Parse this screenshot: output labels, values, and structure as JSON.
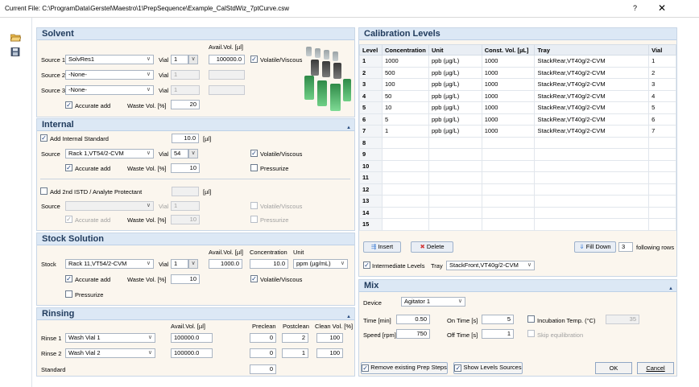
{
  "title": "Current File: C:\\ProgramData\\Gerstel\\Maestro\\1\\PrepSequence\\Example_CalStdWiz_7ptCurve.csw",
  "title_help": "?",
  "title_close": "✕",
  "solvent": {
    "header": "Solvent",
    "avail_vol_header": "Avail.Vol. [µl]",
    "source1_label": "Source 1",
    "source1_value": "SolvRes1",
    "source1_vial_label": "Vial",
    "source1_vial": "1",
    "source1_avail": "100000.0",
    "volatile_label": "Volatile/Viscous",
    "source2_label": "Source 2",
    "source2_value": "-None-",
    "source2_vial_label": "Vial",
    "source2_vial": "1",
    "source3_label": "Source 3",
    "source3_value": "-None-",
    "source3_vial_label": "Vial",
    "source3_vial": "1",
    "accurate_label": "Accurate add",
    "waste_label": "Waste Vol. [%]",
    "waste_value": "20"
  },
  "internal": {
    "header": "Internal",
    "add_is_label": "Add Internal Standard",
    "add_is_value": "10.0",
    "add_is_unit": "[µl]",
    "source_label": "Source",
    "source_value": "Rack 1,VT54/2-CVM",
    "vial_label": "Vial",
    "vial_value": "54",
    "volatile_label": "Volatile/Viscous",
    "accurate_label": "Accurate add",
    "waste_label": "Waste Vol. [%]",
    "waste_value": "10",
    "pressurize_label": "Pressurize",
    "add2_label": "Add 2nd ISTD / Analyte Protectant",
    "add2_unit": "[µl]",
    "source2_label": "Source",
    "vial2_label": "Vial",
    "vial2_value": "1",
    "volatile2_label": "Volatile/Viscous",
    "accurate2_label": "Accurate add",
    "waste2_label": "Waste Vol. [%]",
    "waste2_value": "10",
    "pressurize2_label": "Pressurize"
  },
  "stock": {
    "header": "Stock Solution",
    "avail_header": "Avail.Vol. [µl]",
    "conc_header": "Concentration",
    "unit_header": "Unit",
    "stock_label": "Stock",
    "stock_value": "Rack 11,VT54/2-CVM",
    "vial_label": "Vial",
    "vial_value": "1",
    "avail_value": "1000.0",
    "conc_value": "10.0",
    "unit_value": "ppm (µg/mL)",
    "accurate_label": "Accurate add",
    "waste_label": "Waste Vol. [%]",
    "waste_value": "10",
    "volatile_label": "Volatile/Viscous",
    "pressurize_label": "Pressurize"
  },
  "rinsing": {
    "header": "Rinsing",
    "avail_header": "Avail.Vol. [µl]",
    "preclean_header": "Preclean",
    "postclean_header": "Postclean",
    "cleanvol_header": "Clean Vol. [%]",
    "rinse1_label": "Rinse 1",
    "rinse1_value": "Wash Vial 1",
    "rinse1_avail": "100000.0",
    "rinse1_pre": "0",
    "rinse1_post": "2",
    "rinse1_clean": "100",
    "rinse2_label": "Rinse 2",
    "rinse2_value": "Wash Vial 2",
    "rinse2_avail": "100000.0",
    "rinse2_pre": "0",
    "rinse2_post": "1",
    "rinse2_clean": "100",
    "standard_label": "Standard",
    "standard_pre": "0"
  },
  "calibration": {
    "header": "Calibration Levels",
    "columns": [
      "Level",
      "Concentration",
      "Unit",
      "Const. Vol. [µL]",
      "Tray",
      "Vial"
    ],
    "rows": [
      [
        "1",
        "1000",
        "ppb (µg/L)",
        "1000",
        "StackRear,VT40g/2-CVM",
        "1"
      ],
      [
        "2",
        "500",
        "ppb (µg/L)",
        "1000",
        "StackRear,VT40g/2-CVM",
        "2"
      ],
      [
        "3",
        "100",
        "ppb (µg/L)",
        "1000",
        "StackRear,VT40g/2-CVM",
        "3"
      ],
      [
        "4",
        "50",
        "ppb (µg/L)",
        "1000",
        "StackRear,VT40g/2-CVM",
        "4"
      ],
      [
        "5",
        "10",
        "ppb (µg/L)",
        "1000",
        "StackRear,VT40g/2-CVM",
        "5"
      ],
      [
        "6",
        "5",
        "ppb (µg/L)",
        "1000",
        "StackRear,VT40g/2-CVM",
        "6"
      ],
      [
        "7",
        "1",
        "ppb (µg/L)",
        "1000",
        "StackRear,VT40g/2-CVM",
        "7"
      ],
      [
        "8",
        "",
        "",
        "",
        "",
        ""
      ],
      [
        "9",
        "",
        "",
        "",
        "",
        ""
      ],
      [
        "10",
        "",
        "",
        "",
        "",
        ""
      ],
      [
        "11",
        "",
        "",
        "",
        "",
        ""
      ],
      [
        "12",
        "",
        "",
        "",
        "",
        ""
      ],
      [
        "13",
        "",
        "",
        "",
        "",
        ""
      ],
      [
        "14",
        "",
        "",
        "",
        "",
        ""
      ],
      [
        "15",
        "",
        "",
        "",
        "",
        ""
      ]
    ],
    "insert_label": "Insert",
    "delete_label": "Delete",
    "filldown_label": "Fill Down",
    "filldown_value": "3",
    "following_label": "following rows",
    "intermediate_label": "Intermediate Levels",
    "tray_label": "Tray",
    "tray_value": "StackFront,VT40g/2-CVM"
  },
  "mix": {
    "header": "Mix",
    "device_label": "Device",
    "device_value": "Agitator 1",
    "time_label": "Time [min]",
    "time_value": "0.50",
    "ontime_label": "On Time [s]",
    "ontime_value": "5",
    "incub_label": "Incubation Temp. (°C)",
    "incub_value": "35",
    "speed_label": "Speed [rpm]",
    "speed_value": "750",
    "offtime_label": "Off Time [s]",
    "offtime_value": "1",
    "skip_label": "Skip equilibration"
  },
  "footer": {
    "remove_label": "Remove existing Prep Steps",
    "show_label": "Show Levels Sources",
    "ok_label": "OK",
    "cancel_label": "Cancel"
  },
  "colors": {
    "header_bg": "#dce8f5",
    "panel_bg": "#fbf6ee",
    "accent": "#1f3a5c"
  },
  "icons": [
    "open-folder-icon",
    "save-icon",
    "insert-row-icon",
    "delete-row-icon",
    "fill-down-icon",
    "vials-image"
  ]
}
